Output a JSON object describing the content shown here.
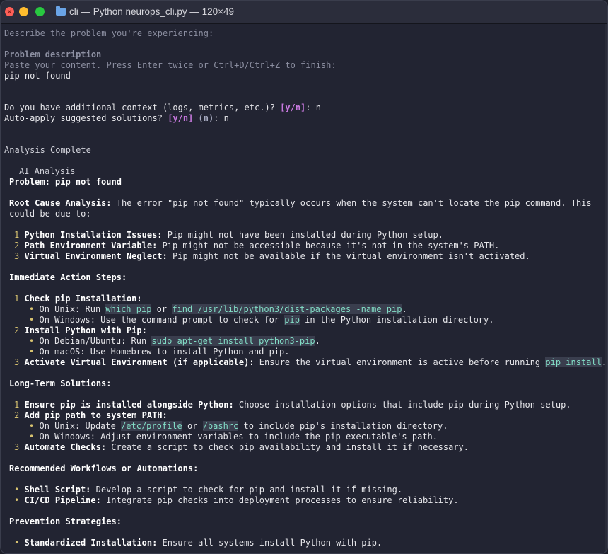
{
  "window": {
    "title": "cli — Python neurops_cli.py — 120×49"
  },
  "terminal": {
    "prompt_describe": "Describe the problem you're experiencing:",
    "problem_desc_label": "Problem description",
    "paste_hint": "Paste your content. Press Enter twice or Ctrl+D/Ctrl+Z to finish:",
    "user_input": "pip not found",
    "context_q": "Do you have additional context (logs, metrics, etc.)? ",
    "context_choice": "[y/n]",
    "context_ans": ": n",
    "apply_q": "Auto-apply suggested solutions? ",
    "apply_choice": "[y/n]",
    "apply_default": " (n)",
    "apply_ans": ": n",
    "analysis_complete": "Analysis Complete",
    "ai_analysis": "AI Analysis",
    "problem_line": "Problem: pip not found",
    "rca_label": "Root Cause Analysis:",
    "rca_text": " The error \"pip not found\" typically occurs when the system can't locate the pip command. This",
    "rca_text2": "could be due to:",
    "causes": [
      {
        "num": "1",
        "title": "Python Installation Issues:",
        "text": " Pip might not have been installed during Python setup."
      },
      {
        "num": "2",
        "title": "Path Environment Variable:",
        "text": " Pip might not be accessible because it's not in the system's PATH."
      },
      {
        "num": "3",
        "title": "Virtual Environment Neglect:",
        "text": " Pip might not be available if the virtual environment isn't activated."
      }
    ],
    "immediate_heading": "Immediate Action Steps:",
    "step1_title": "Check pip Installation:",
    "step1_b1_pre": "On Unix: Run ",
    "step1_b1_code1": "which pip",
    "step1_b1_mid": " or ",
    "step1_b1_code2": "find /usr/lib/python3/dist-packages -name pip",
    "step1_b1_end": ".",
    "step1_b2_pre": "On Windows: Use the command prompt to check for ",
    "step1_b2_code": "pip",
    "step1_b2_end": " in the Python installation directory.",
    "step2_title": "Install Python with Pip:",
    "step2_b1_pre": "On Debian/Ubuntu: Run ",
    "step2_b1_code": "sudo apt-get install python3-pip",
    "step2_b1_end": ".",
    "step2_b2": "On macOS: Use Homebrew to install Python and pip.",
    "step3_title": "Activate Virtual Environment (if applicable):",
    "step3_text": " Ensure the virtual environment is active before running ",
    "step3_code": "pip install",
    "step3_end": ".",
    "longterm_heading": "Long-Term Solutions:",
    "lt1_title": "Ensure pip is installed alongside Python:",
    "lt1_text": " Choose installation options that include pip during Python setup.",
    "lt2_title": "Add pip path to system PATH:",
    "lt2_b1_pre": "On Unix: Update ",
    "lt2_b1_code1": "/etc/profile",
    "lt2_b1_mid": " or ",
    "lt2_b1_code2": "/bashrc",
    "lt2_b1_end": " to include pip's installation directory.",
    "lt2_b2": "On Windows: Adjust environment variables to include the pip executable's path.",
    "lt3_title": "Automate Checks:",
    "lt3_text": " Create a script to check pip availability and install it if necessary.",
    "workflows_heading": "Recommended Workflows or Automations:",
    "wf": [
      {
        "title": "Shell Script:",
        "text": " Develop a script to check for pip and install it if missing."
      },
      {
        "title": "CI/CD Pipeline:",
        "text": " Integrate pip checks into deployment processes to ensure reliability."
      }
    ],
    "prevention_heading": "Prevention Strategies:",
    "prev1_title": "Standardized Installation:",
    "prev1_text": " Ensure all systems install Python with pip.",
    "num1": "1",
    "num2": "2",
    "num3": "3",
    "bullet": "•"
  }
}
